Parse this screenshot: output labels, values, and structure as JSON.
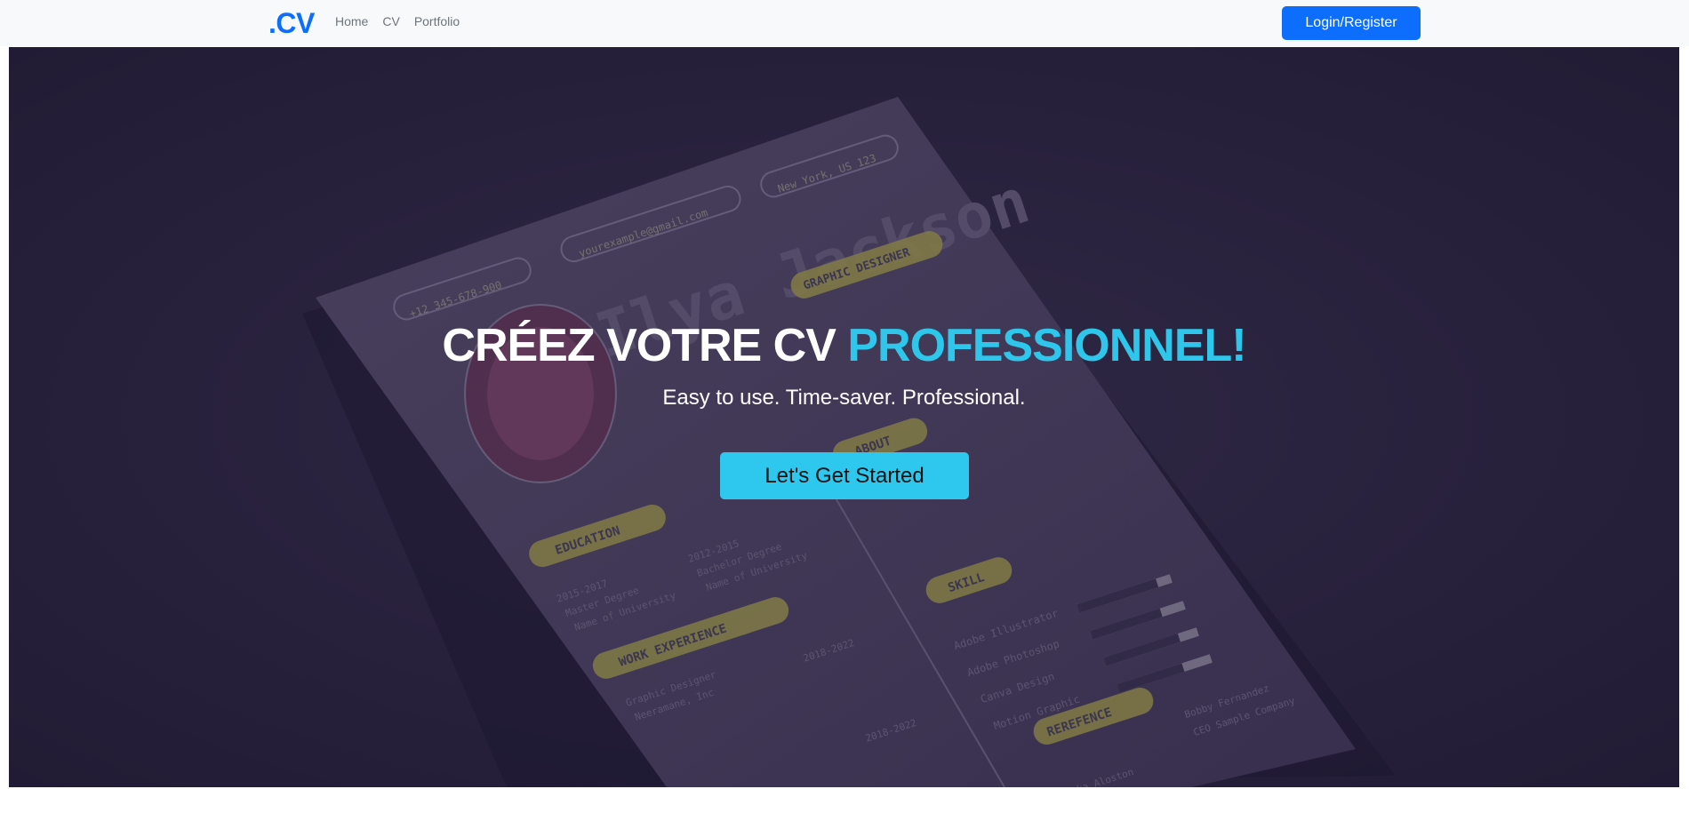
{
  "navbar": {
    "brand_dot": ".",
    "brand_text": "CV",
    "links": [
      {
        "label": "Home"
      },
      {
        "label": "CV"
      },
      {
        "label": "Portfolio"
      }
    ],
    "login_label": "Login/Register"
  },
  "hero": {
    "title_main": "CRÉEZ VOTRE CV",
    "title_accent": "PROFESSIONNEL!",
    "subtitle": "Easy to use. Time-saver. Professional.",
    "cta_label": "Let's Get Started",
    "background_image": {
      "name": "Ilya Jackson",
      "role": "GRAPHIC DESIGNER",
      "phone": "+12 345-678-900",
      "email": "yourexample@gmail.com",
      "location": "New York, US 123",
      "sections": [
        "ABOUT",
        "EDUCATION",
        "WORK EXPERIENCE",
        "SKILL",
        "REREFENCE"
      ],
      "education": [
        {
          "years": "2015-2017",
          "line1": "Master Degree",
          "line2": "Name of University"
        },
        {
          "years": "2012-2015",
          "line1": "Bachelor Degree",
          "line2": "Name of University"
        }
      ],
      "work": [
        {
          "years": "2018-2022",
          "title": "Graphic Designer",
          "company": "Neeramane, Inc"
        },
        {
          "years": "2018-2022",
          "title": "Graphic Designer",
          "company": "Inc"
        }
      ],
      "skills": [
        "Adobe Illustrator",
        "Adobe Photoshop",
        "Canva Design",
        "Motion Graphic"
      ],
      "skill_levels": [
        0.85,
        0.75,
        0.8,
        0.7
      ],
      "reference": [
        {
          "name": "Bobby Fernandez",
          "company": "CEO Sample Company"
        },
        {
          "name": "Riska Aloston"
        }
      ]
    }
  },
  "colors": {
    "brand_blue": "#0d6efd",
    "accent_cyan": "#2ec6ea",
    "hero_bg": "#2a2340",
    "tag_yellow": "#b8b050"
  }
}
